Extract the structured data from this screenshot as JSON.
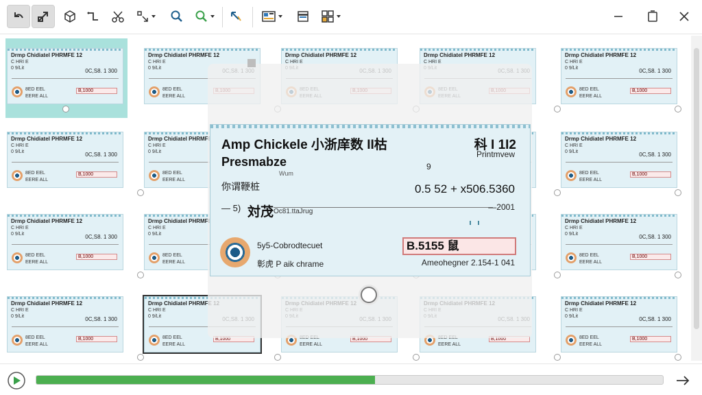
{
  "toolbar": {
    "buttons": [
      {
        "name": "undo-icon",
        "active": true
      },
      {
        "name": "expand-icon",
        "active": true
      },
      {
        "name": "cube-icon"
      },
      {
        "name": "route-icon"
      },
      {
        "name": "scissors-icon"
      },
      {
        "name": "transform-icon",
        "caret": true
      },
      {
        "name": "zoom-icon"
      },
      {
        "name": "zoom-green-icon",
        "caret": true
      },
      {
        "name": "arrow-up-left-icon"
      },
      {
        "name": "image-layout-icon",
        "caret": true
      },
      {
        "name": "stack-icon"
      },
      {
        "name": "grid-layout-icon",
        "caret": true
      }
    ],
    "window_controls": [
      "minimize-icon",
      "restore-icon",
      "close-icon"
    ]
  },
  "thumbnail": {
    "title": "Drmp Chidiatel PHRMFE 12",
    "sub1": "C HRI E",
    "sub2": "0 9/Lit",
    "amount": "0C,S8. 1 300",
    "memo1": "8ED EEL",
    "memo2": "EERE ALL",
    "box": "B,1000"
  },
  "preview": {
    "title": "Amp Chickele 小浙庠数 II枯",
    "number": "科 I 1I2",
    "printview": "Printmvew",
    "payee": "Presmabze",
    "small": "Wum",
    "digit": "9",
    "chinese": "你谓鞭桩",
    "amount": "0.5 52 + x506.5360",
    "dash": "— 5)",
    "sign": "対茂",
    "sigsmall": "Oc81.ttaJrug",
    "date": "—2001",
    "memo1": "5y5-Cobrodtecuet",
    "memo2": "彰虎 P aik chrame",
    "box": "B.5155 鼠",
    "signer": "Ameohegner  2.154-1 041"
  },
  "progress": {
    "value": 0.54
  },
  "colors": {
    "accent": "#4caf50",
    "selection": "#a9e1dc",
    "check_bg": "#e2f1f6"
  }
}
